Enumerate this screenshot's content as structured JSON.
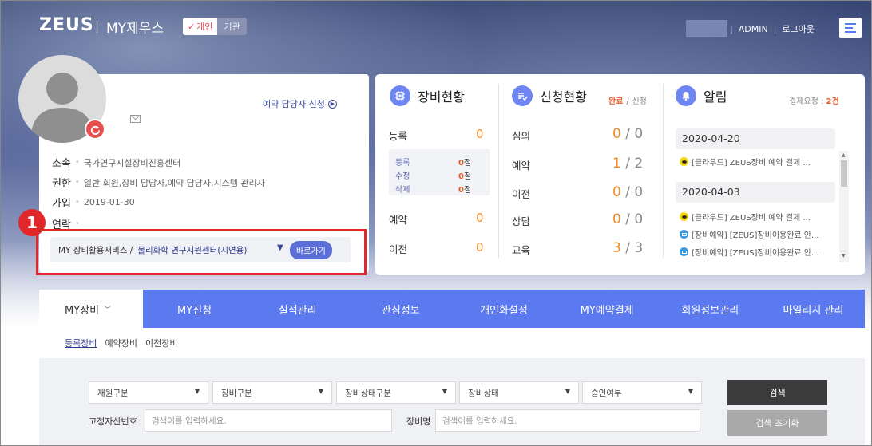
{
  "header": {
    "logo": "ZEUS",
    "separator": "|",
    "site_title": "MY제우스",
    "toggle_personal": "개인",
    "toggle_org": "기관",
    "admin": "ADMIN",
    "link_sep": "|",
    "logout": "로그아웃"
  },
  "profile": {
    "reserve_manager_link": "예약 담당자 신청",
    "affiliation_label": "소속",
    "affiliation_value": "국가연구시설장비진흥센터",
    "role_label": "권한",
    "role_value": "일반 회원,장비 담당자,예약 담당자,시스템 관리자",
    "joined_label": "가입",
    "joined_value": "2019-01-30",
    "contact_label": "연락",
    "service_prefix": "MY 장비활용서비스 /",
    "service_center": "물리화학 연구지원센터(시연용)",
    "service_go": "바로가기",
    "annotation_number": "1"
  },
  "equipment": {
    "title": "장비현황",
    "registered_label": "등록",
    "registered_count": "0",
    "sub": [
      {
        "label": "등록",
        "count": "0",
        "unit": "점"
      },
      {
        "label": "수정",
        "count": "0",
        "unit": "점"
      },
      {
        "label": "삭제",
        "count": "0",
        "unit": "점"
      }
    ],
    "reserve_label": "예약",
    "reserve_count": "0",
    "transfer_label": "이전",
    "transfer_count": "0"
  },
  "requests": {
    "title": "신청현황",
    "done_label": "완료",
    "slash": "/",
    "apply_label": "신청",
    "rows": [
      {
        "label": "심의",
        "done": "0",
        "total": "0"
      },
      {
        "label": "예약",
        "done": "1",
        "total": "2"
      },
      {
        "label": "이전",
        "done": "0",
        "total": "0"
      },
      {
        "label": "상담",
        "done": "0",
        "total": "0"
      },
      {
        "label": "교육",
        "done": "3",
        "total": "3"
      }
    ]
  },
  "alerts": {
    "title": "알림",
    "pending_label": "결제요청 :",
    "pending_count": "2건",
    "dates": [
      "2020-04-20",
      "2020-04-03"
    ],
    "items": [
      {
        "icon": "talk-icon",
        "text": "[클라우드] ZEUS장비 예약 결제 ..."
      },
      {
        "icon": "talk-icon",
        "text": "[클라우드] ZEUS장비 예약 결제 ..."
      },
      {
        "icon": "mail-icon",
        "text": "[장비예약] [ZEUS]장비이용완료 안..."
      },
      {
        "icon": "mail-icon",
        "text": "[장비예약] [ZEUS]장비이용완료 안..."
      }
    ]
  },
  "nav": {
    "first": "MY장비",
    "tabs": [
      "MY신청",
      "실적관리",
      "관심정보",
      "개인화설정",
      "MY예약결제",
      "회원정보관리",
      "마일리지 관리"
    ]
  },
  "subtabs": [
    "등록장비",
    "예약장비",
    "이전장비"
  ],
  "search": {
    "selects": [
      "재원구분",
      "장비구분",
      "장비상태구분",
      "장비상태",
      "승인여부"
    ],
    "asset_label": "고정자산번호",
    "asset_placeholder": "검색어를 입력하세요.",
    "name_label": "장비명",
    "name_placeholder": "검색어를 입력하세요.",
    "search_button": "검색",
    "reset_button": "검색 초기화"
  },
  "colors": {
    "accent": "#5b7af0",
    "highlight": "#e3262a",
    "count_orange": "#f28a24"
  }
}
